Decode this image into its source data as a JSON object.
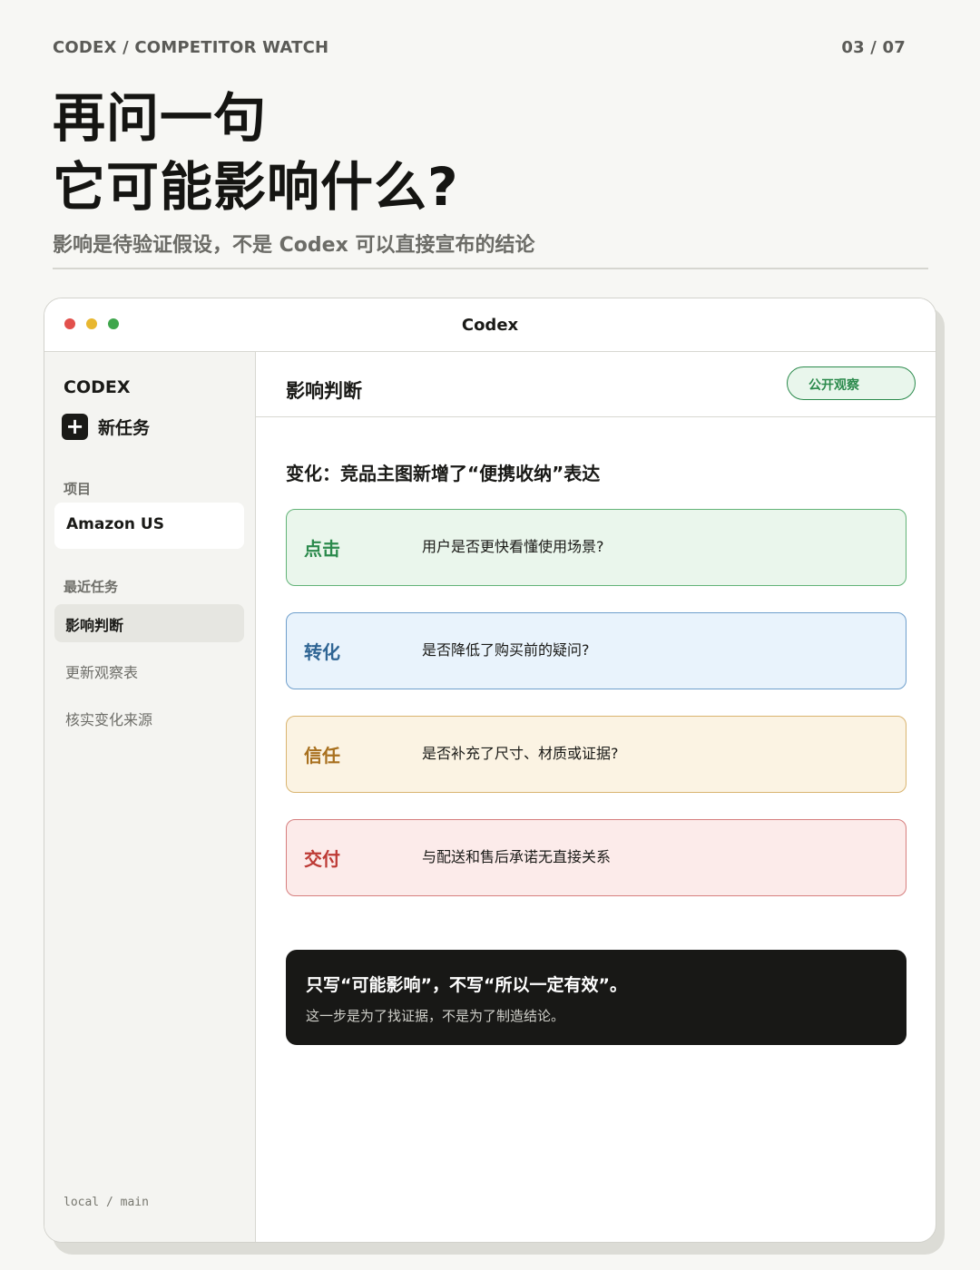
{
  "meta": {
    "brand_path": "CODEX / COMPETITOR WATCH",
    "page_counter": "03 / 07"
  },
  "headline": {
    "line1": "再问一句",
    "line2": "它可能影响什么?"
  },
  "subhead": "影响是待验证假设，不是 Codex 可以直接宣布的结论",
  "window": {
    "title": "Codex"
  },
  "sidebar": {
    "brand": "CODEX",
    "new_task_label": "新任务",
    "projects_label": "项目",
    "project": "Amazon US",
    "recent_label": "最近任务",
    "tasks": [
      {
        "label": "影响判断",
        "active": true
      },
      {
        "label": "更新观察表",
        "active": false
      },
      {
        "label": "核实变化来源",
        "active": false
      }
    ],
    "branch": "local / main"
  },
  "main": {
    "title": "影响判断",
    "status": "公开观察",
    "change": "变化：竞品主图新增了“便携收纳”表达",
    "factors": [
      {
        "label": "点击",
        "question": "用户是否更快看懂使用场景?"
      },
      {
        "label": "转化",
        "question": "是否降低了购买前的疑问?"
      },
      {
        "label": "信任",
        "question": "是否补充了尺寸、材质或证据?"
      },
      {
        "label": "交付",
        "question": "与配送和售后承诺无直接关系"
      }
    ],
    "callout": {
      "main": "只写“可能影响”，不写“所以一定有效”。",
      "sub": "这一步是为了找证据，不是为了制造结论。"
    }
  },
  "colors": {
    "click": "#2b8a4c",
    "conversion": "#2f6594",
    "trust": "#a8701e",
    "delivery": "#bd3a35"
  }
}
